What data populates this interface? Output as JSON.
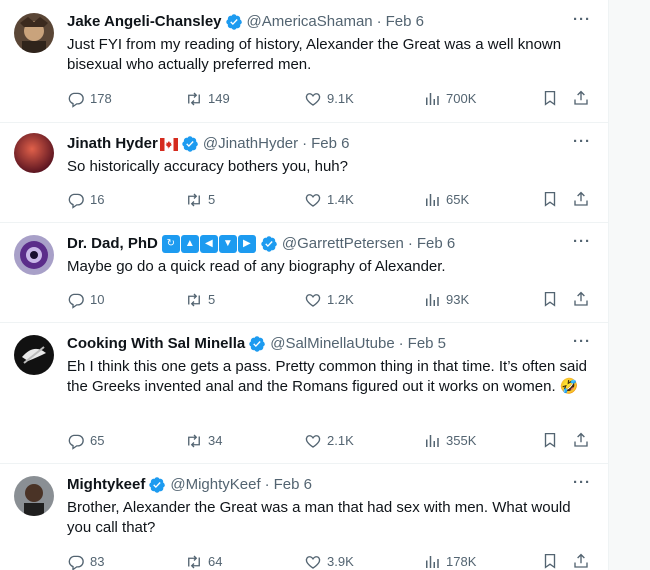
{
  "tweets": [
    {
      "name": "Jake Angeli-Chansley",
      "handle": "@AmericaShaman",
      "separator": "·",
      "date": "Feb 6",
      "text": "Just FYI from my reading of history, Alexander the Great was a well known bisexual who actually preferred men.",
      "replies": "178",
      "retweets": "149",
      "likes": "9.1K",
      "views": "700K"
    },
    {
      "name": "Jinath Hyder",
      "handle": "@JinathHyder",
      "separator": "·",
      "date": "Feb 6",
      "text": "So historically accuracy bothers you, huh?",
      "replies": "16",
      "retweets": "5",
      "likes": "1.4K",
      "views": "65K"
    },
    {
      "name": "Dr. Dad, PhD",
      "handle": "@GarrettPetersen",
      "separator": "·",
      "date": "Feb 6",
      "text": "Maybe go do a quick read of any biography of Alexander.",
      "replies": "10",
      "retweets": "5",
      "likes": "1.2K",
      "views": "93K"
    },
    {
      "name": "Cooking With Sal Minella",
      "handle": "@SalMinellaUtube",
      "separator": "·",
      "date": "Feb 5",
      "text": "Eh I think this one gets a pass. Pretty common thing in that time. It’s often said the Greeks invented anal and the Romans figured out it works on women. 🤣",
      "replies": "65",
      "retweets": "34",
      "likes": "2.1K",
      "views": "355K"
    },
    {
      "name": "Mightykeef",
      "handle": "@MightyKeef",
      "separator": "·",
      "date": "Feb 6",
      "text": "Brother, Alexander the Great was a man that had sex with men. What would you call that?",
      "replies": "83",
      "retweets": "64",
      "likes": "3.9K",
      "views": "178K"
    }
  ],
  "more_glyph": "···",
  "icons": {
    "verified": "verified-badge-icon",
    "reply": "reply-bubble-icon",
    "retweet": "retweet-arrows-icon",
    "like": "heart-icon",
    "views": "bar-chart-icon",
    "bookmark": "bookmark-icon",
    "share": "share-upload-icon",
    "flag": "canada-flag-icon"
  },
  "colors": {
    "text": "#0f1419",
    "secondary": "#536471",
    "verified": "#1d9bf0",
    "divider": "#eff3f4"
  }
}
